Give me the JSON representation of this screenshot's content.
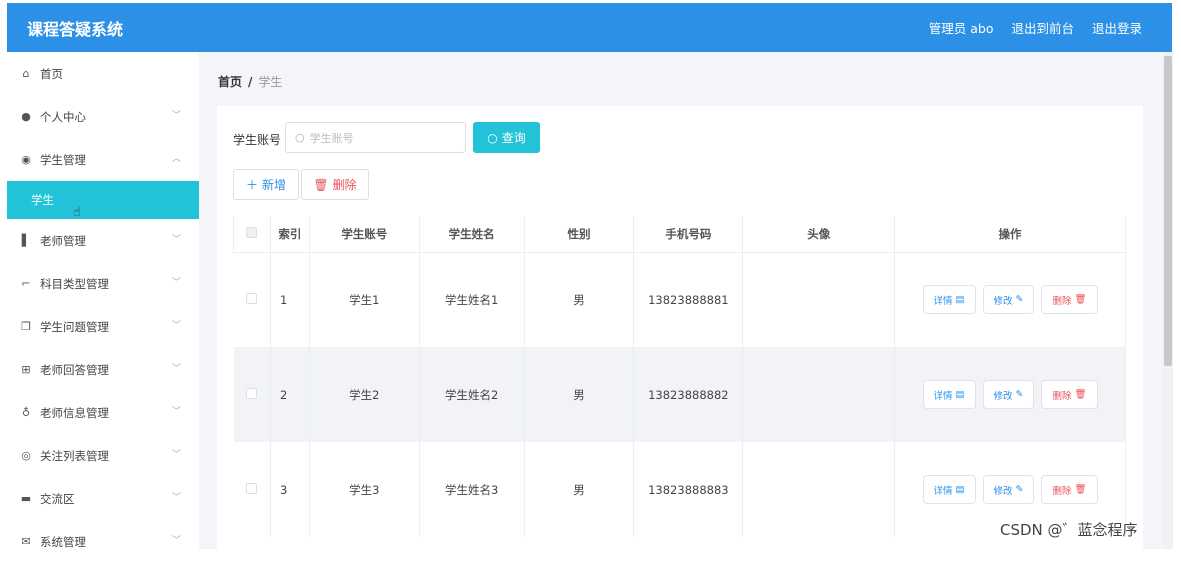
{
  "app": {
    "title": "课程答疑系统"
  },
  "topnav": {
    "user": "管理员 abo",
    "to_front": "退出到前台",
    "logout": "退出登录"
  },
  "sidebar": {
    "items": [
      {
        "label": "首页",
        "icon": "home-icon",
        "glyph": "⌂",
        "has_chevron": false
      },
      {
        "label": "个人中心",
        "icon": "user-icon",
        "glyph": "●",
        "has_chevron": true,
        "chevron": "﹀"
      },
      {
        "label": "学生管理",
        "icon": "location-icon",
        "glyph": "◉",
        "has_chevron": true,
        "chevron": "︿"
      },
      {
        "label": "老师管理",
        "icon": "bar-chart-icon",
        "glyph": "▌",
        "has_chevron": true,
        "chevron": "﹀"
      },
      {
        "label": "科目类型管理",
        "icon": "crop-icon",
        "glyph": "⌐",
        "has_chevron": true,
        "chevron": "﹀"
      },
      {
        "label": "学生问题管理",
        "icon": "copy-icon",
        "glyph": "❐",
        "has_chevron": true,
        "chevron": "﹀"
      },
      {
        "label": "老师回答管理",
        "icon": "grid-icon",
        "glyph": "⊞",
        "has_chevron": true,
        "chevron": "﹀"
      },
      {
        "label": "老师信息管理",
        "icon": "microphone-icon",
        "glyph": "♁",
        "has_chevron": true,
        "chevron": "﹀"
      },
      {
        "label": "关注列表管理",
        "icon": "target-icon",
        "glyph": "◎",
        "has_chevron": true,
        "chevron": "﹀"
      },
      {
        "label": "交流区",
        "icon": "briefcase-icon",
        "glyph": "▬",
        "has_chevron": true,
        "chevron": "﹀"
      },
      {
        "label": "系统管理",
        "icon": "mail-icon",
        "glyph": "✉",
        "has_chevron": true,
        "chevron": "﹀"
      }
    ],
    "active_sub": "学生"
  },
  "breadcrumb": {
    "home": "首页",
    "sep": "/",
    "current": "学生"
  },
  "search": {
    "label": "学生账号",
    "placeholder": "学生账号",
    "button": "查询"
  },
  "toolbar": {
    "add": "新增",
    "delete": "删除"
  },
  "table": {
    "headers": [
      "索引",
      "学生账号",
      "学生姓名",
      "性别",
      "手机号码",
      "头像",
      "操作"
    ],
    "rows": [
      {
        "index": "1",
        "account": "学生1",
        "name": "学生姓名1",
        "gender": "男",
        "phone": "13823888881",
        "avatar": ""
      },
      {
        "index": "2",
        "account": "学生2",
        "name": "学生姓名2",
        "gender": "男",
        "phone": "13823888882",
        "avatar": ""
      },
      {
        "index": "3",
        "account": "学生3",
        "name": "学生姓名3",
        "gender": "男",
        "phone": "13823888883",
        "avatar": ""
      }
    ],
    "actions": {
      "detail": "详情",
      "edit": "修改",
      "remove": "删除"
    }
  },
  "watermark": "CSDN @゛蓝念程序",
  "colors": {
    "topbar": "#2b90e6",
    "accent": "#22c3d8",
    "danger": "#e8525b",
    "row_alt": "#f2f3f7"
  }
}
